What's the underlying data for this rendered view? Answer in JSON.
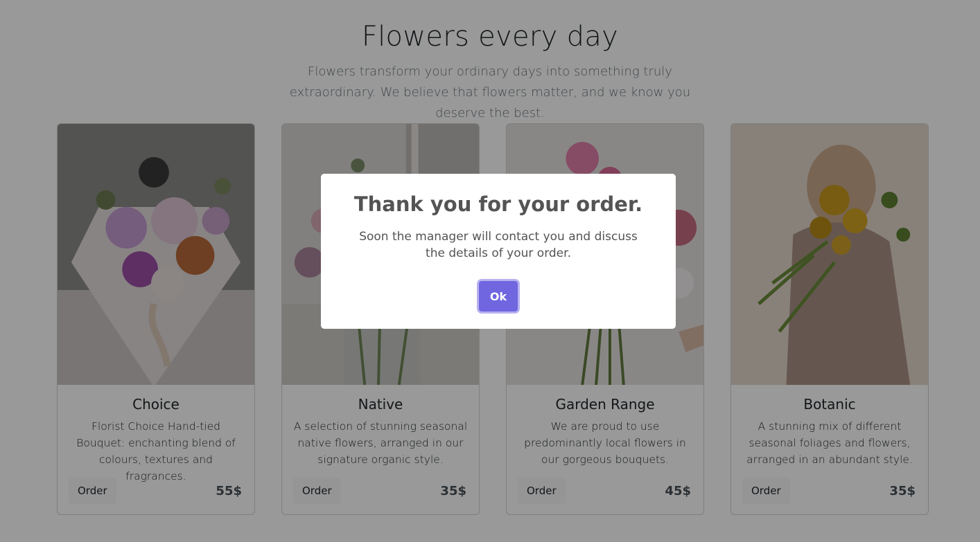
{
  "hero": {
    "title": "Flowers every day",
    "subtitle": "Flowers transform your ordinary days into something truly extraordinary. We believe that flowers matter, and we know you deserve the best."
  },
  "cards": [
    {
      "title": "Choice",
      "text": "Florist Choice Hand-tied Bouquet: enchanting blend of colours, textures and fragrances.",
      "order_label": "Order",
      "price": "55$"
    },
    {
      "title": "Native",
      "text": "A selection of stunning seasonal native flowers, arranged in our signature organic style.",
      "order_label": "Order",
      "price": "35$"
    },
    {
      "title": "Garden Range",
      "text": "We are proud to use predominantly local flowers in our gorgeous bouquets.",
      "order_label": "Order",
      "price": "45$"
    },
    {
      "title": "Botanic",
      "text": "A stunning mix of different seasonal foliages and flowers, arranged in an abundant style.",
      "order_label": "Order",
      "price": "35$"
    }
  ],
  "modal": {
    "title": "Thank you for your order.",
    "text": "Soon the manager will contact you and discuss the details of your order.",
    "ok_label": "Ok"
  },
  "colors": {
    "accent": "#7066e0",
    "overlay": "rgba(0,0,0,0.4)",
    "modal_text": "#545454"
  }
}
